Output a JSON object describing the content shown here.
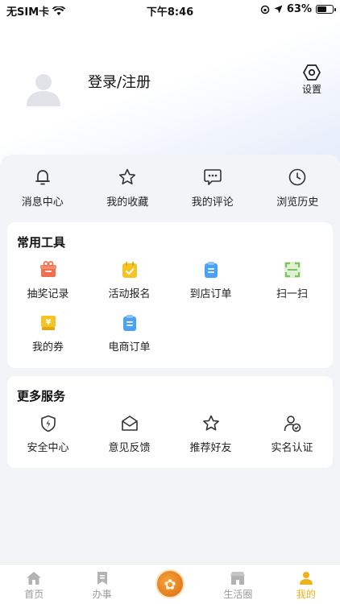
{
  "status": {
    "carrier": "无SIM卡",
    "time": "下午8:46",
    "battery": "63%",
    "battery_level": 0.63
  },
  "profile": {
    "login_label": "登录/注册",
    "settings_label": "设置"
  },
  "quick": [
    {
      "label": "消息中心",
      "icon": "bell-icon"
    },
    {
      "label": "我的收藏",
      "icon": "star-icon"
    },
    {
      "label": "我的评论",
      "icon": "comment-icon"
    },
    {
      "label": "浏览历史",
      "icon": "clock-icon"
    }
  ],
  "tools": {
    "title": "常用工具",
    "items": [
      {
        "label": "抽奖记录",
        "icon": "lottery-icon",
        "color": "#f06f4e"
      },
      {
        "label": "活动报名",
        "icon": "signup-icon",
        "color": "#f6c325"
      },
      {
        "label": "到店订单",
        "icon": "clipboard-icon",
        "color": "#4aa2f5"
      },
      {
        "label": "扫一扫",
        "icon": "scan-icon",
        "color": "#7cc35a"
      },
      {
        "label": "我的券",
        "icon": "coupon-icon",
        "color": "#f6c325"
      },
      {
        "label": "电商订单",
        "icon": "order-icon",
        "color": "#4aa2f5"
      }
    ]
  },
  "services": {
    "title": "更多服务",
    "items": [
      {
        "label": "安全中心",
        "icon": "shield-icon"
      },
      {
        "label": "意见反馈",
        "icon": "mail-icon"
      },
      {
        "label": "推荐好友",
        "icon": "star-icon"
      },
      {
        "label": "实名认证",
        "icon": "verified-user-icon"
      }
    ]
  },
  "tabs": [
    {
      "label": "首页",
      "icon": "home-icon"
    },
    {
      "label": "办事",
      "icon": "bookmark-icon"
    },
    {
      "label": "",
      "icon": "logo-icon"
    },
    {
      "label": "生活圈",
      "icon": "shop-icon"
    },
    {
      "label": "我的",
      "icon": "user-icon"
    }
  ],
  "colors": {
    "accent": "#f0b21a",
    "inactive": "#9a9a9a"
  }
}
